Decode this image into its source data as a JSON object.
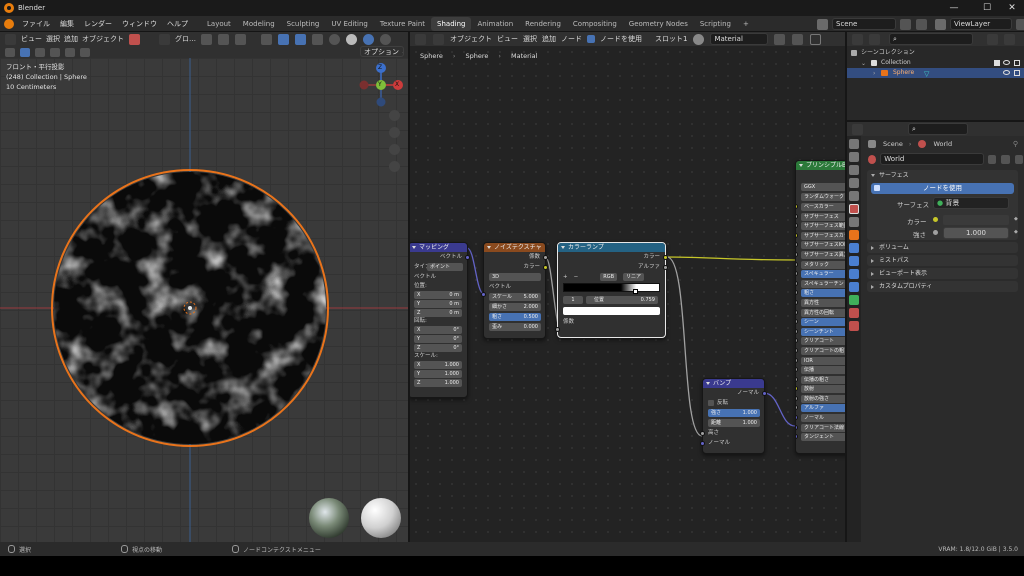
{
  "app": {
    "title": "Blender"
  },
  "window_controls": {
    "min": "—",
    "max": "☐",
    "close": "✕"
  },
  "menu": [
    "ファイル",
    "編集",
    "レンダー",
    "ウィンドウ",
    "ヘルプ"
  ],
  "workspaces": {
    "tabs": [
      "Layout",
      "Modeling",
      "Sculpting",
      "UV Editing",
      "Texture Paint",
      "Shading",
      "Animation",
      "Rendering",
      "Compositing",
      "Geometry Nodes",
      "Scripting"
    ],
    "active": "Shading",
    "add": "+"
  },
  "scene": {
    "name": "Scene",
    "view_layer": "ViewLayer"
  },
  "viewport": {
    "header": {
      "view": "ビュー",
      "select": "選択",
      "add": "追加",
      "object": "オブジェクト",
      "transform": "グロ…",
      "options": "オプション ⌄"
    },
    "overlay": {
      "line1": "フロント・平行投影",
      "line2": "(248) Collection | Sphere",
      "line3": "10 Centimeters"
    },
    "gizmo": {
      "z": "Z",
      "y": "Y",
      "x": "X"
    }
  },
  "node_editor": {
    "header": {
      "object": "オブジェクト",
      "view": "ビュー",
      "select": "選択",
      "add": "追加",
      "node": "ノード",
      "use_nodes": "ノードを使用",
      "slot": "スロット1",
      "material": "Material"
    },
    "breadcrumb": [
      "Sphere",
      "Sphere",
      "Material"
    ],
    "nodes": {
      "mapping": {
        "title": "マッピング",
        "vector_out": "ベクトル",
        "type_label": "タイプ:",
        "type_value": "ポイント",
        "vector_in": "ベクトル",
        "location_label": "位置:",
        "location": [
          {
            "k": "X",
            "v": "0 m"
          },
          {
            "k": "Y",
            "v": "0 m"
          },
          {
            "k": "Z",
            "v": "0 m"
          }
        ],
        "rotation_label": "回転:",
        "rotation": [
          {
            "k": "X",
            "v": "0°"
          },
          {
            "k": "Y",
            "v": "0°"
          },
          {
            "k": "Z",
            "v": "0°"
          }
        ],
        "scale_label": "スケール:",
        "scale": [
          {
            "k": "X",
            "v": "1.000"
          },
          {
            "k": "Y",
            "v": "1.000"
          },
          {
            "k": "Z",
            "v": "1.000"
          }
        ]
      },
      "noise": {
        "title": "ノイズテクスチャ",
        "fac": "係数",
        "color": "カラー",
        "dim": "3D",
        "vector": "ベクトル",
        "params": [
          {
            "k": "スケール",
            "v": "5.000"
          },
          {
            "k": "細かさ",
            "v": "2.000"
          },
          {
            "k": "粗さ",
            "v": "0.500"
          },
          {
            "k": "歪み",
            "v": "0.000"
          }
        ]
      },
      "colorramp": {
        "title": "カラーランプ",
        "color": "カラー",
        "alpha": "アルファ",
        "plus": "+",
        "minus": "−",
        "mode": "RGB",
        "interp": "リニア",
        "index": "1",
        "pos_label": "位置",
        "pos_value": "0.759",
        "stop_position": 0.759,
        "fac": "係数"
      },
      "bump": {
        "title": "バンプ",
        "normal_out": "ノーマル",
        "invert": "反転",
        "strength_k": "強さ",
        "strength_v": "1.000",
        "distance_k": "距離",
        "distance_v": "1.000",
        "height": "高さ",
        "normal_in": "ノーマル"
      },
      "principled": {
        "title": "プリンシプルBSDF",
        "dist": "GGX",
        "sss": "ランダムウォーク",
        "rows": [
          "ベースカラー",
          "サブサーフェス",
          "サブサーフェス範囲",
          "サブサーフェスカラー",
          "サブサーフェスIOR",
          "サブサーフェス異方性",
          "メタリック",
          "スペキュラー",
          "スペキュラーチント",
          "粗さ",
          "異方性",
          "異方性の回転",
          "シーン",
          "シーンチント",
          "クリアコート",
          "クリアコートの粗さ",
          "IOR",
          "伝播",
          "伝播の粗さ",
          "放射",
          "放射の強さ",
          "アルファ",
          "ノーマル",
          "クリアコート法線",
          "タンジェント"
        ]
      }
    }
  },
  "outliner": {
    "scene_collection": "シーンコレクション",
    "collection": "Collection",
    "object": "Sphere"
  },
  "properties": {
    "breadcrumb": [
      "Scene",
      "World"
    ],
    "world_name": "World",
    "panels": {
      "surface": "サーフェス",
      "use_nodes_btn": "ノードを使用",
      "surface_label": "サーフェス",
      "surface_value": "背景",
      "color_label": "カラー",
      "strength_label": "強さ",
      "strength_value": "1.000",
      "collapsed": [
        "ボリューム",
        "ミストパス",
        "ビューポート表示",
        "カスタムプロパティ"
      ]
    }
  },
  "statusbar": {
    "select": "選択",
    "rotate": "視点の移動",
    "context": "ノードコンテクストメニュー",
    "vram": "VRAM: 1.8/12.0 GiB | 3.5.0"
  },
  "colors": {
    "accent": "#4772b3",
    "orange": "#e87d0d",
    "header_noise": "#8a4a1e",
    "header_input": "#3a3a8f",
    "header_conv": "#246283",
    "header_shader": "#2c7a3a"
  }
}
